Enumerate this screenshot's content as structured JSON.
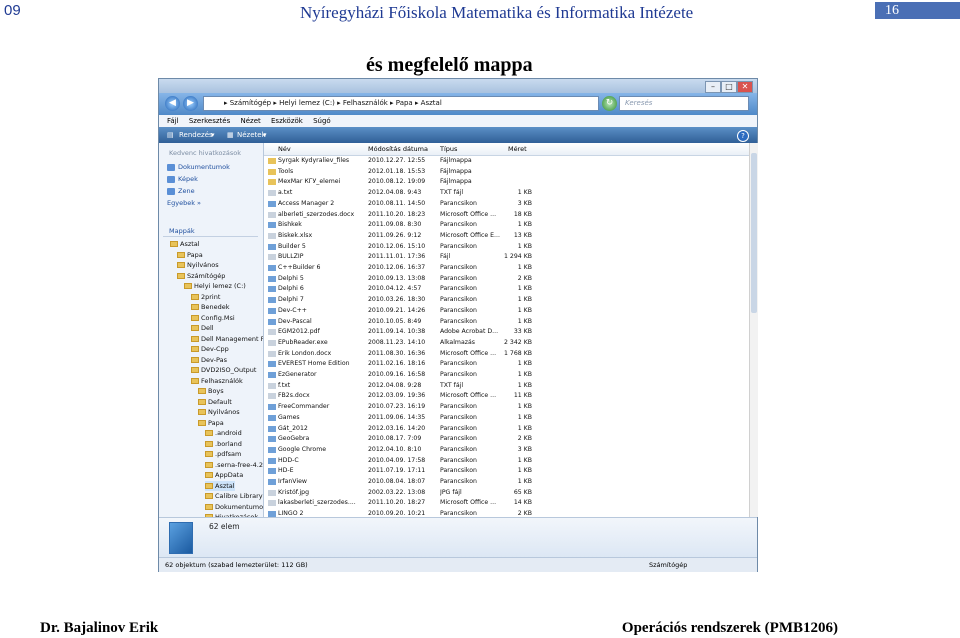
{
  "slide": {
    "number_left": "09",
    "header": "Nyíregyházi Főiskola Matematika és Informatika Intézete",
    "number_right": "16",
    "title": "és megfelelő mappa",
    "footer_left": "Dr. Bajalinov Erik",
    "footer_right": "Operációs rendszerek (PMB1206)"
  },
  "window": {
    "address": "▸ Számítógép ▸ Helyi lemez (C:) ▸ Felhasználók ▸ Papa ▸ Asztal",
    "search_placeholder": "Keresés",
    "menu": [
      "Fájl",
      "Szerkesztés",
      "Nézet",
      "Eszközök",
      "Súgó"
    ],
    "toolbar": {
      "organize": "Rendezés",
      "views": "Nézetek"
    },
    "favorites_header": "Kedvenc hivatkozások",
    "favorites": [
      "Dokumentumok",
      "Képek",
      "Zene",
      "Egyebek »"
    ],
    "folders_header": "Mappák",
    "tree": [
      {
        "label": "Asztal",
        "indent": 1
      },
      {
        "label": "Papa",
        "indent": 2
      },
      {
        "label": "Nyilvános",
        "indent": 2
      },
      {
        "label": "Számítógép",
        "indent": 2
      },
      {
        "label": "Helyi lemez (C:)",
        "indent": 3
      },
      {
        "label": "2print",
        "indent": 4
      },
      {
        "label": "Benedek",
        "indent": 4
      },
      {
        "label": "Config.Msi",
        "indent": 4
      },
      {
        "label": "Dell",
        "indent": 4
      },
      {
        "label": "Dell Management P",
        "indent": 4
      },
      {
        "label": "Dev-Cpp",
        "indent": 4
      },
      {
        "label": "Dev-Pas",
        "indent": 4
      },
      {
        "label": "DVD2ISO_Output",
        "indent": 4
      },
      {
        "label": "Felhasználók",
        "indent": 4
      },
      {
        "label": "Boys",
        "indent": 5
      },
      {
        "label": "Default",
        "indent": 5
      },
      {
        "label": "Nyilvános",
        "indent": 5
      },
      {
        "label": "Papa",
        "indent": 5
      },
      {
        "label": ".android",
        "indent": 6
      },
      {
        "label": ".borland",
        "indent": 6
      },
      {
        "label": ".pdfsam",
        "indent": 6
      },
      {
        "label": ".serna-free-4.2",
        "indent": 6
      },
      {
        "label": "AppData",
        "indent": 6
      },
      {
        "label": "Asztal",
        "indent": 6,
        "selected": true
      },
      {
        "label": "Calibre Library",
        "indent": 6
      },
      {
        "label": "Dokumentumo",
        "indent": 6
      },
      {
        "label": "Hivatkozások",
        "indent": 6
      }
    ],
    "columns": [
      "Név",
      "Módosítás dátuma",
      "Típus",
      "Méret"
    ],
    "rows": [
      [
        "Syrgak Kydyraliev_files",
        "2010.12.27. 12:55",
        "Fájlmappa",
        ""
      ],
      [
        "Tools",
        "2012.01.18. 15:53",
        "Fájlmappa",
        ""
      ],
      [
        "MexMar КГУ_elemei",
        "2010.08.12. 19:09",
        "Fájlmappa",
        ""
      ],
      [
        "a.txt",
        "2012.04.08. 9:43",
        "TXT fájl",
        "1 KB"
      ],
      [
        "Access Manager 2",
        "2010.08.11. 14:50",
        "Parancsikon",
        "3 KB"
      ],
      [
        "alberleti_szerzodes.docx",
        "2011.10.20. 18:23",
        "Microsoft Office ...",
        "18 KB"
      ],
      [
        "Bishkek",
        "2011.09.08. 8:30",
        "Parancsikon",
        "1 KB"
      ],
      [
        "Biskek.xlsx",
        "2011.09.26. 9:12",
        "Microsoft Office E...",
        "13 KB"
      ],
      [
        "Builder 5",
        "2010.12.06. 15:10",
        "Parancsikon",
        "1 KB"
      ],
      [
        "BULLZIP",
        "2011.11.01. 17:36",
        "Fájl",
        "1 294 KB"
      ],
      [
        "C++Builder 6",
        "2010.12.06. 16:37",
        "Parancsikon",
        "1 KB"
      ],
      [
        "Delphi 5",
        "2010.09.13. 13:08",
        "Parancsikon",
        "2 KB"
      ],
      [
        "Delphi 6",
        "2010.04.12. 4:57",
        "Parancsikon",
        "1 KB"
      ],
      [
        "Delphi 7",
        "2010.03.26. 18:30",
        "Parancsikon",
        "1 KB"
      ],
      [
        "Dev-C++",
        "2010.09.21. 14:26",
        "Parancsikon",
        "1 KB"
      ],
      [
        "Dev-Pascal",
        "2010.10.05. 8:49",
        "Parancsikon",
        "1 KB"
      ],
      [
        "EGM2012.pdf",
        "2011.09.14. 10:38",
        "Adobe Acrobat D...",
        "33 KB"
      ],
      [
        "EPubReader.exe",
        "2008.11.23. 14:10",
        "Alkalmazás",
        "2 342 KB"
      ],
      [
        "Erik London.docx",
        "2011.08.30. 16:36",
        "Microsoft Office ...",
        "1 768 KB"
      ],
      [
        "EVEREST Home Edition",
        "2011.02.16. 18:16",
        "Parancsikon",
        "1 KB"
      ],
      [
        "EzGenerator",
        "2010.09.16. 16:58",
        "Parancsikon",
        "1 KB"
      ],
      [
        "f.txt",
        "2012.04.08. 9:28",
        "TXT fájl",
        "1 KB"
      ],
      [
        "FB2s.docx",
        "2012.03.09. 19:36",
        "Microsoft Office ...",
        "11 KB"
      ],
      [
        "FreeCommander",
        "2010.07.23. 16:19",
        "Parancsikon",
        "1 KB"
      ],
      [
        "Games",
        "2011.09.06. 14:35",
        "Parancsikon",
        "1 KB"
      ],
      [
        "Gát_2012",
        "2012.03.16. 14:20",
        "Parancsikon",
        "1 KB"
      ],
      [
        "GeoGebra",
        "2010.08.17. 7:09",
        "Parancsikon",
        "2 KB"
      ],
      [
        "Google Chrome",
        "2012.04.10. 8:10",
        "Parancsikon",
        "3 KB"
      ],
      [
        "HDD-C",
        "2010.04.09. 17:58",
        "Parancsikon",
        "1 KB"
      ],
      [
        "HD-E",
        "2011.07.19. 17:11",
        "Parancsikon",
        "1 KB"
      ],
      [
        "IrfanView",
        "2010.08.04. 18:07",
        "Parancsikon",
        "1 KB"
      ],
      [
        "Kristóf.jpg",
        "2002.03.22. 13:08",
        "JPG fájl",
        "65 KB"
      ],
      [
        "lakasberleti_szerzodes....",
        "2011.10.20. 18:27",
        "Microsoft Office ...",
        "14 KB"
      ],
      [
        "LINGO 2",
        "2010.09.20. 10:21",
        "Parancsikon",
        "2 KB"
      ]
    ],
    "details": "62 elem",
    "status_left": "62 objektum (szabad lemezterület: 112 GB)",
    "status_right": "Számítógép"
  }
}
